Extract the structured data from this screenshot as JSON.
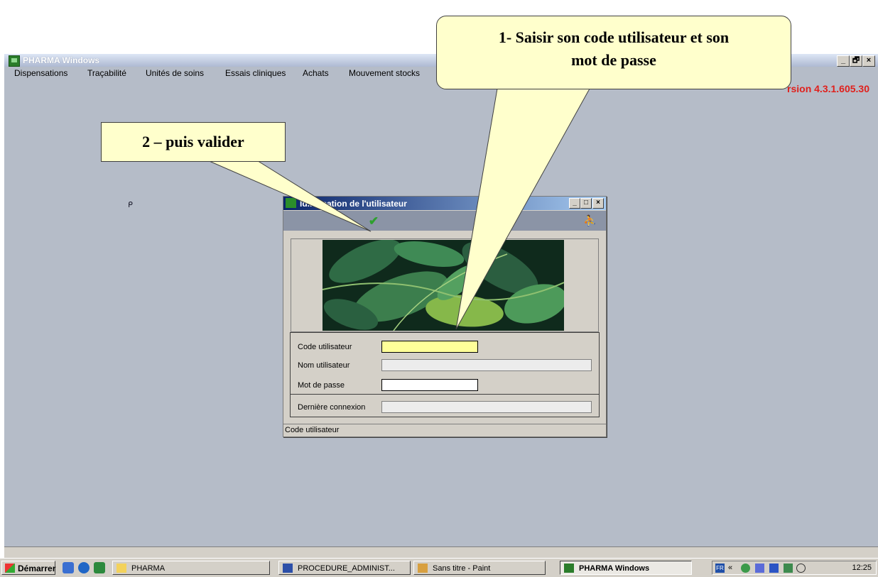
{
  "app": {
    "title": "PHARMA Windows",
    "version": "rsion 4.3.1.605.30",
    "window_controls": [
      "_",
      "🗗",
      "×"
    ],
    "menu": [
      "Dispensations",
      "Traçabilité",
      "Unités de soins",
      "Essais cliniques",
      "Achats",
      "Mouvement stocks"
    ]
  },
  "dialog": {
    "title": "Identification de l'utilisateur",
    "title_visible": "Id...ification de l'utilisateur",
    "controls": [
      "_",
      "□",
      "×"
    ],
    "toolbar": {
      "validate_icon": "checkmark-icon",
      "quit_icon": "exit-person-icon"
    },
    "image": "leaves-photo",
    "fields": [
      {
        "label": "Code utilisateur",
        "value": "",
        "state": "focused"
      },
      {
        "label": "Nom utilisateur",
        "value": "",
        "state": "disabled"
      },
      {
        "label": "Mot de passe",
        "value": "",
        "state": "editable"
      },
      {
        "label": "Dernière connexion",
        "value": "",
        "state": "disabled"
      }
    ],
    "status_text": "Code utilisateur"
  },
  "callouts": {
    "step1": [
      "1- Saisir son code utilisateur et son",
      "mot de passe"
    ],
    "step2": "2 – puis valider"
  },
  "taskbar": {
    "start_label": "Démarrer",
    "buttons": [
      "PHARMA",
      "PROCEDURE_ADMINIST...",
      "Sans titre - Paint",
      "PHARMA Windows"
    ],
    "tray_lang": "FR",
    "tray_chevron": "«",
    "clock": "12:25"
  },
  "colors": {
    "desktop": "#b5bcc8",
    "callout_fill": "#ffffcc",
    "version_red": "#e0201c",
    "focused_field": "#ffff99"
  }
}
